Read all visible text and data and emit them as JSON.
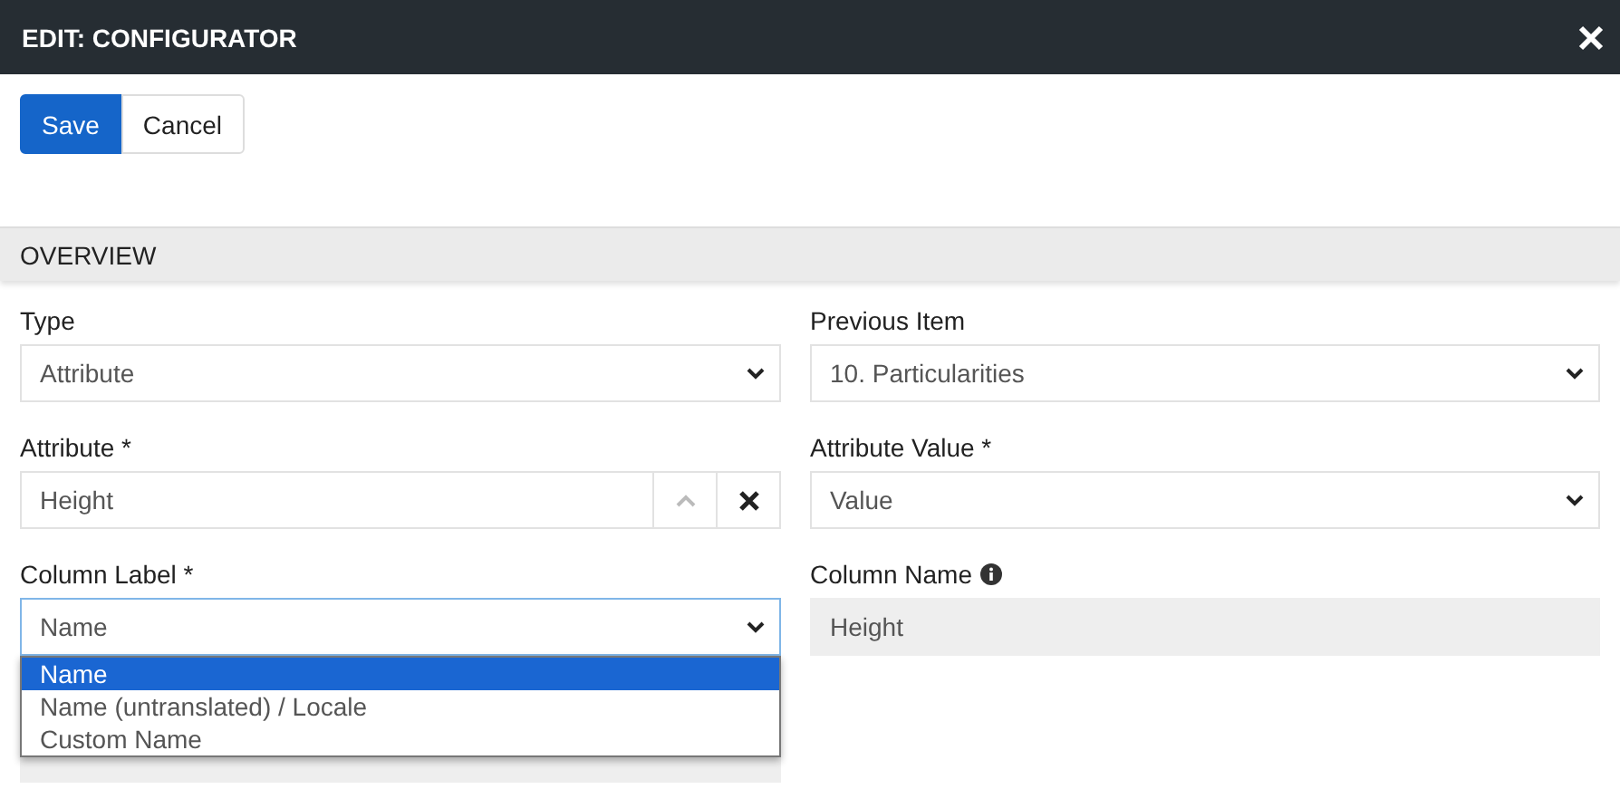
{
  "dialog": {
    "title": "EDIT: CONFIGURATOR"
  },
  "toolbar": {
    "buttons": [
      {
        "label": "Save",
        "kind": "primary"
      },
      {
        "label": "Cancel",
        "kind": "default"
      }
    ]
  },
  "section": {
    "title": "OVERVIEW"
  },
  "fields": [
    {
      "label": "Type",
      "kind": "select",
      "value": "Attribute"
    },
    {
      "label": "Previous Item",
      "kind": "select",
      "value": "10. Particularities"
    },
    {
      "label": "Attribute *",
      "kind": "lookup",
      "value": "Height"
    },
    {
      "label": "Attribute Value *",
      "kind": "select",
      "value": "Value"
    },
    {
      "label": "Column Label *",
      "kind": "select",
      "value": "Name",
      "focused": true,
      "expanded": true,
      "options": [
        {
          "label": "Name",
          "selected": true
        },
        {
          "label": "Name (untranslated) / Locale",
          "selected": false
        },
        {
          "label": "Custom Name",
          "selected": false
        }
      ]
    },
    {
      "label": "Column Name",
      "kind": "readonly",
      "value": "Height",
      "info": true
    },
    {
      "kind": "readonly"
    }
  ]
}
